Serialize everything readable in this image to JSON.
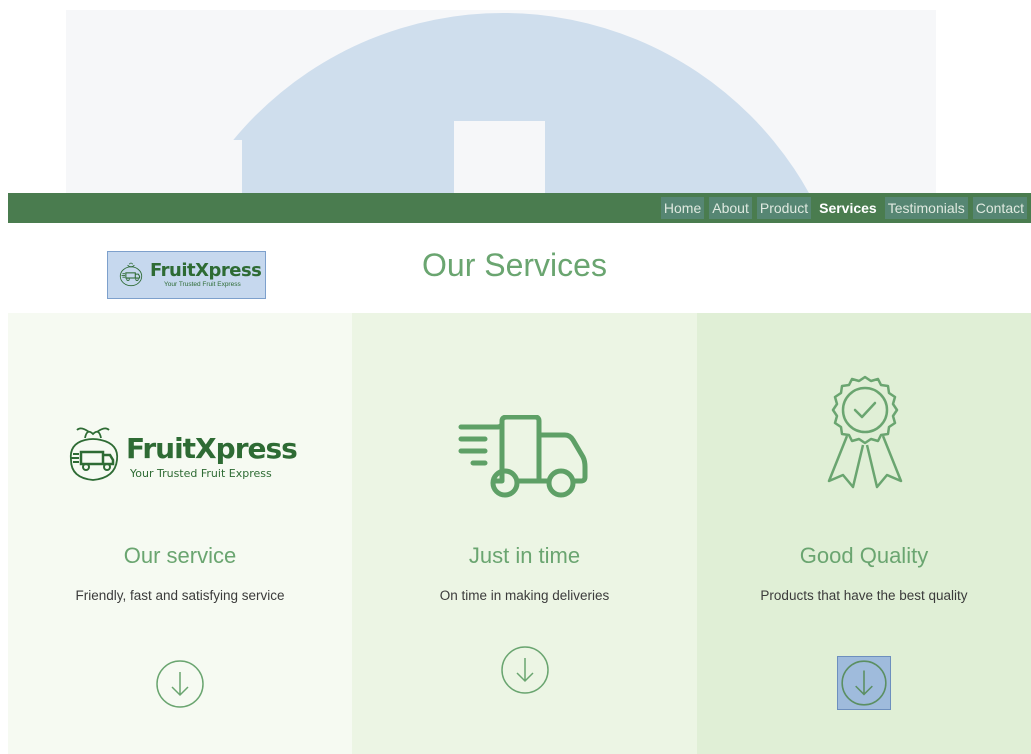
{
  "nav": {
    "items": [
      {
        "label": "Home"
      },
      {
        "label": "About"
      },
      {
        "label": "Product"
      },
      {
        "label": "Services"
      },
      {
        "label": "Testimonials"
      },
      {
        "label": "Contact"
      }
    ],
    "active": "Services"
  },
  "header": {
    "logo": {
      "name": "FruitXpress",
      "tagline": "Your Trusted Fruit Express"
    },
    "title": "Our Services"
  },
  "services": [
    {
      "icon": "fruitxpress-logo-icon",
      "logo_name": "FruitXpress",
      "logo_tagline": "Your Trusted Fruit Express",
      "title": "Our service",
      "description": "Friendly, fast and satisfying service"
    },
    {
      "icon": "delivery-truck-icon",
      "title": "Just in time",
      "description": "On time in making deliveries"
    },
    {
      "icon": "award-ribbon-icon",
      "title": "Good Quality",
      "description": "Products that have the best quality"
    }
  ],
  "colors": {
    "nav_bg": "#4a7c4f",
    "accent_green": "#6aa570",
    "card_1_bg": "#f6faf2",
    "card_2_bg": "#ecf5e4",
    "card_3_bg": "#e0efd6"
  }
}
